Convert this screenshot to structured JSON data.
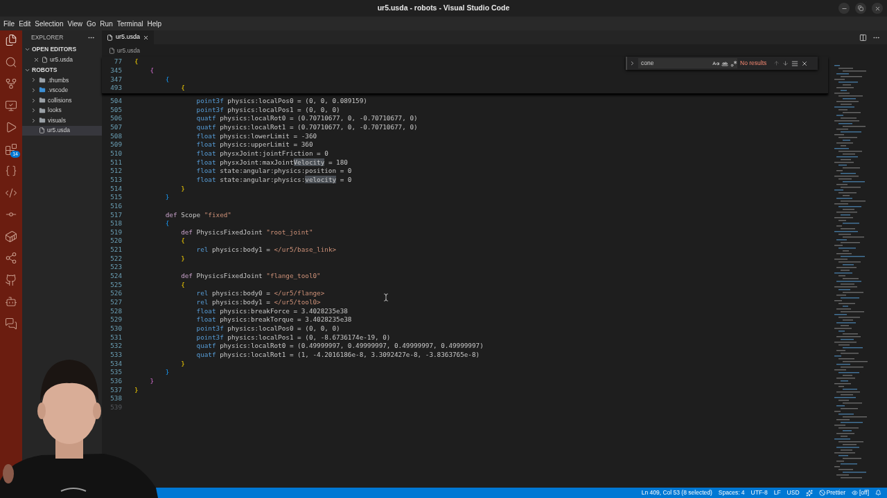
{
  "window": {
    "title": "ur5.usda - robots - Visual Studio Code"
  },
  "menu": [
    "File",
    "Edit",
    "Selection",
    "View",
    "Go",
    "Run",
    "Terminal",
    "Help"
  ],
  "activity_bar": [
    {
      "kind": "files",
      "selected": true
    },
    {
      "kind": "search",
      "selected": false
    },
    {
      "kind": "branch",
      "selected": false
    },
    {
      "kind": "monitor",
      "selected": false
    },
    {
      "kind": "run",
      "selected": false
    },
    {
      "kind": "blocks",
      "selected": false,
      "badge": "14"
    },
    {
      "kind": "json",
      "selected": false
    },
    {
      "kind": "code",
      "selected": false
    },
    {
      "kind": "commit",
      "selected": false
    },
    {
      "kind": "container",
      "selected": false
    },
    {
      "kind": "share",
      "selected": false
    },
    {
      "kind": "github",
      "selected": false
    },
    {
      "kind": "bot",
      "selected": false
    },
    {
      "kind": "chat",
      "selected": false
    }
  ],
  "sidebar": {
    "title": "EXPLORER",
    "sections": [
      {
        "title": "OPEN EDITORS",
        "expanded": true,
        "items": [
          {
            "label": "ur5.usda",
            "kind": "file",
            "selected": false,
            "closable": true
          }
        ]
      },
      {
        "title": "ROBOTS",
        "expanded": true,
        "items": [
          {
            "label": ".thumbs",
            "kind": "folder",
            "expanded": false,
            "selected": false
          },
          {
            "label": ".vscode",
            "kind": "vscode-folder",
            "expanded": false,
            "selected": false
          },
          {
            "label": "collisions",
            "kind": "folder",
            "expanded": false,
            "selected": false
          },
          {
            "label": "looks",
            "kind": "folder",
            "expanded": false,
            "selected": false
          },
          {
            "label": "visuals",
            "kind": "folder",
            "expanded": false,
            "selected": false
          },
          {
            "label": "ur5.usda",
            "kind": "file",
            "selected": true
          }
        ]
      }
    ]
  },
  "tabs": [
    {
      "label": "ur5.usda",
      "selected": true
    }
  ],
  "breadcrumb": [
    "ur5.usda"
  ],
  "find": {
    "value": "cone",
    "result": "No results"
  },
  "sticky_lines": [
    {
      "number": "77",
      "tokens": [
        {
          "kind": "brace1",
          "text": "{"
        }
      ]
    },
    {
      "number": "345",
      "tokens": [
        {
          "kind": "brace2",
          "text": "    {"
        }
      ]
    },
    {
      "number": "347",
      "tokens": [
        {
          "kind": "brace3",
          "text": "        {"
        }
      ]
    },
    {
      "number": "493",
      "tokens": [
        {
          "kind": "brace1",
          "text": "            {"
        }
      ]
    }
  ],
  "lines": [
    {
      "number": "504",
      "tokens": [
        {
          "kind": "type",
          "text": "                point3f"
        },
        {
          "kind": "plain",
          "text": " physics:localPos0 = (0, 0, 0.089159)"
        }
      ]
    },
    {
      "number": "505",
      "tokens": [
        {
          "kind": "type",
          "text": "                point3f"
        },
        {
          "kind": "plain",
          "text": " physics:localPos1 = (0, 0, 0)"
        }
      ]
    },
    {
      "number": "506",
      "tokens": [
        {
          "kind": "type",
          "text": "                quatf"
        },
        {
          "kind": "plain",
          "text": " physics:localRot0 = (0.70710677, 0, -0.70710677, 0)"
        }
      ]
    },
    {
      "number": "507",
      "tokens": [
        {
          "kind": "type",
          "text": "                quatf"
        },
        {
          "kind": "plain",
          "text": " physics:localRot1 = (0.70710677, 0, -0.70710677, 0)"
        }
      ]
    },
    {
      "number": "508",
      "tokens": [
        {
          "kind": "type",
          "text": "                float"
        },
        {
          "kind": "plain",
          "text": " physics:lowerLimit = -360"
        }
      ]
    },
    {
      "number": "509",
      "tokens": [
        {
          "kind": "type",
          "text": "                float"
        },
        {
          "kind": "plain",
          "text": " physics:upperLimit = 360"
        }
      ]
    },
    {
      "number": "510",
      "tokens": [
        {
          "kind": "type",
          "text": "                float"
        },
        {
          "kind": "plain",
          "text": " physxJoint:jointFriction = 0"
        }
      ]
    },
    {
      "number": "511",
      "tokens": [
        {
          "kind": "type",
          "text": "                float"
        },
        {
          "kind": "plain",
          "text": " physxJoint:maxJoint"
        },
        {
          "kind": "match",
          "text": "Velocity"
        },
        {
          "kind": "plain",
          "text": " = 180"
        }
      ]
    },
    {
      "number": "512",
      "tokens": [
        {
          "kind": "type",
          "text": "                float"
        },
        {
          "kind": "plain",
          "text": " state:angular:physics:position = 0"
        }
      ]
    },
    {
      "number": "513",
      "tokens": [
        {
          "kind": "type",
          "text": "                float"
        },
        {
          "kind": "plain",
          "text": " state:angular:physics:"
        },
        {
          "kind": "match",
          "text": "velocity"
        },
        {
          "kind": "plain",
          "text": " = 0"
        }
      ]
    },
    {
      "number": "514",
      "tokens": [
        {
          "kind": "brace1",
          "text": "            }"
        }
      ]
    },
    {
      "number": "515",
      "tokens": [
        {
          "kind": "brace3",
          "text": "        }"
        }
      ]
    },
    {
      "number": "516"
    },
    {
      "number": "517",
      "tokens": [
        {
          "kind": "def",
          "text": "        def"
        },
        {
          "kind": "plain",
          "text": " Scope "
        },
        {
          "kind": "string",
          "text": "\"fixed\""
        }
      ]
    },
    {
      "number": "518",
      "tokens": [
        {
          "kind": "brace3",
          "text": "        {"
        }
      ]
    },
    {
      "number": "519",
      "tokens": [
        {
          "kind": "def",
          "text": "            def"
        },
        {
          "kind": "plain",
          "text": " PhysicsFixedJoint "
        },
        {
          "kind": "string",
          "text": "\"root_joint\""
        }
      ]
    },
    {
      "number": "520",
      "tokens": [
        {
          "kind": "brace1",
          "text": "            {"
        }
      ]
    },
    {
      "number": "521",
      "tokens": [
        {
          "kind": "type",
          "text": "                rel"
        },
        {
          "kind": "plain",
          "text": " physics:body1 = "
        },
        {
          "kind": "string",
          "text": "</ur5/base_link>"
        }
      ]
    },
    {
      "number": "522",
      "tokens": [
        {
          "kind": "brace1",
          "text": "            }"
        }
      ]
    },
    {
      "number": "523"
    },
    {
      "number": "524",
      "tokens": [
        {
          "kind": "def",
          "text": "            def"
        },
        {
          "kind": "plain",
          "text": " PhysicsFixedJoint "
        },
        {
          "kind": "string",
          "text": "\"flange_tool0\""
        }
      ]
    },
    {
      "number": "525",
      "tokens": [
        {
          "kind": "brace1",
          "text": "            {"
        }
      ]
    },
    {
      "number": "526",
      "tokens": [
        {
          "kind": "type",
          "text": "                rel"
        },
        {
          "kind": "plain",
          "text": " physics:body0 = "
        },
        {
          "kind": "string",
          "text": "</ur5/flange>"
        }
      ]
    },
    {
      "number": "527",
      "tokens": [
        {
          "kind": "type",
          "text": "                rel"
        },
        {
          "kind": "plain",
          "text": " physics:body1 = "
        },
        {
          "kind": "string",
          "text": "</ur5/tool0>"
        }
      ]
    },
    {
      "number": "528",
      "tokens": [
        {
          "kind": "type",
          "text": "                float"
        },
        {
          "kind": "plain",
          "text": " physics:breakForce = 3.4028235e38"
        }
      ]
    },
    {
      "number": "529",
      "tokens": [
        {
          "kind": "type",
          "text": "                float"
        },
        {
          "kind": "plain",
          "text": " physics:breakTorque = 3.4028235e38"
        }
      ]
    },
    {
      "number": "530",
      "tokens": [
        {
          "kind": "type",
          "text": "                point3f"
        },
        {
          "kind": "plain",
          "text": " physics:localPos0 = (0, 0, 0)"
        }
      ]
    },
    {
      "number": "531",
      "tokens": [
        {
          "kind": "type",
          "text": "                point3f"
        },
        {
          "kind": "plain",
          "text": " physics:localPos1 = (0, -8.6736174e-19, 0)"
        }
      ]
    },
    {
      "number": "532",
      "tokens": [
        {
          "kind": "type",
          "text": "                quatf"
        },
        {
          "kind": "plain",
          "text": " physics:localRot0 = (0.49999997, 0.49999997, 0.49999997, 0.49999997)"
        }
      ]
    },
    {
      "number": "533",
      "tokens": [
        {
          "kind": "type",
          "text": "                quatf"
        },
        {
          "kind": "plain",
          "text": " physics:localRot1 = (1, -4.2016186e-8, 3.3092427e-8, -3.8363765e-8)"
        }
      ]
    },
    {
      "number": "534",
      "tokens": [
        {
          "kind": "brace1",
          "text": "            }"
        }
      ]
    },
    {
      "number": "535",
      "tokens": [
        {
          "kind": "brace3",
          "text": "        }"
        }
      ]
    },
    {
      "number": "536",
      "tokens": [
        {
          "kind": "brace2",
          "text": "    }"
        }
      ]
    },
    {
      "number": "537",
      "tokens": [
        {
          "kind": "brace1",
          "text": "}"
        }
      ]
    },
    {
      "number": "538"
    },
    {
      "number": "539",
      "faded": true
    }
  ],
  "status_bar": [
    {
      "kind": "text",
      "text": "Ln 409, Col 53 (8 selected)"
    },
    {
      "kind": "text",
      "text": "Spaces: 4"
    },
    {
      "kind": "text",
      "text": "UTF-8"
    },
    {
      "kind": "text",
      "text": "LF"
    },
    {
      "kind": "text",
      "text": "USD"
    },
    {
      "kind": "copilot"
    },
    {
      "kind": "prettier",
      "text": "Prettier"
    },
    {
      "kind": "eye",
      "text": "[off]"
    },
    {
      "kind": "bell"
    }
  ]
}
